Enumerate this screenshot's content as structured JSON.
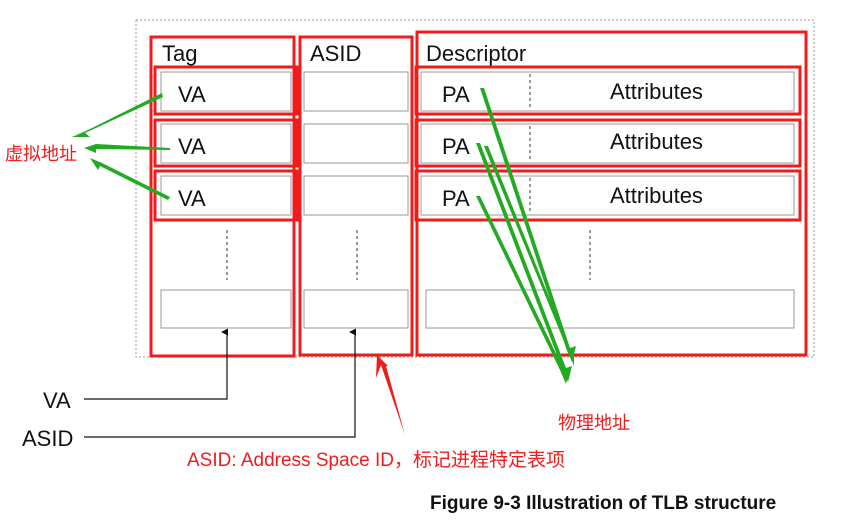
{
  "diagram": {
    "headers": {
      "tag": "Tag",
      "asid": "ASID",
      "descriptor": "Descriptor"
    },
    "rows": [
      {
        "tag": "VA",
        "pa": "PA",
        "attributes": "Attributes"
      },
      {
        "tag": "VA",
        "pa": "PA",
        "attributes": "Attributes"
      },
      {
        "tag": "VA",
        "pa": "PA",
        "attributes": "Attributes"
      }
    ],
    "inputs": {
      "va": "VA",
      "asid": "ASID"
    },
    "annotations": {
      "virtual_address": "虚拟地址",
      "physical_address": "物理地址",
      "asid_note": "ASID: Address Space ID，标记进程特定表项"
    },
    "caption": "Figure 9-3 Illustration of TLB structure",
    "colors": {
      "highlight": "#f01c1c",
      "arrow": "#22aa22",
      "cell_border": "#999999"
    }
  }
}
